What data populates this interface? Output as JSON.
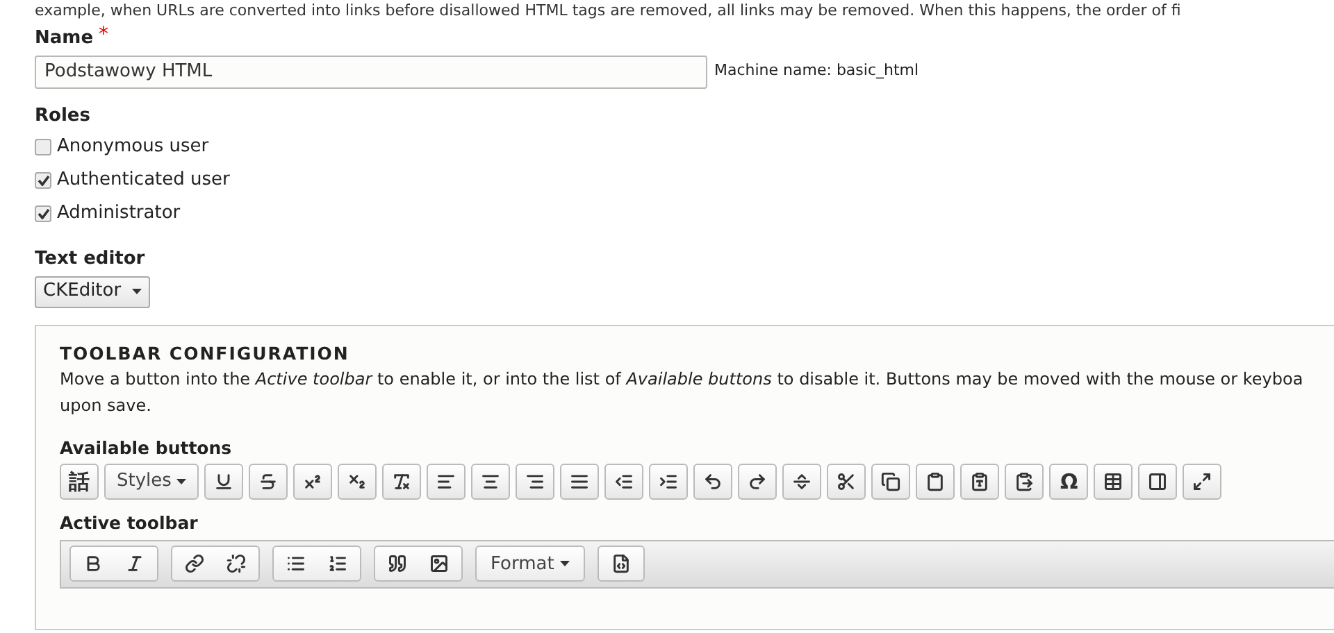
{
  "intro_text": "example, when URLs are converted into links before disallowed HTML tags are removed, all links may be removed. When this happens, the order of fi",
  "name_field": {
    "label": "Name",
    "required_mark": "*",
    "value": "Podstawowy HTML",
    "machine_name": "Machine name: basic_html"
  },
  "roles": {
    "label": "Roles",
    "items": [
      {
        "label": "Anonymous user",
        "checked": false
      },
      {
        "label": "Authenticated user",
        "checked": true
      },
      {
        "label": "Administrator",
        "checked": true
      }
    ]
  },
  "text_editor": {
    "label": "Text editor",
    "value": "CKEditor"
  },
  "toolbar_configuration": {
    "title": "TOOLBAR CONFIGURATION",
    "description": [
      "Move a button into the *Active toolbar* to enable it, or into the list of *Available buttons* to disable it. Buttons may be moved with the mouse or keyboa",
      "upon save."
    ],
    "available_label": "Available buttons",
    "available_buttons": [
      {
        "kind": "text",
        "label": "話"
      },
      {
        "kind": "dropdown",
        "label": "Styles"
      },
      {
        "kind": "icon"
      },
      {
        "kind": "icon"
      },
      {
        "kind": "icon"
      },
      {
        "kind": "icon"
      },
      {
        "kind": "icon"
      },
      {
        "kind": "icon"
      },
      {
        "kind": "icon"
      },
      {
        "kind": "icon"
      },
      {
        "kind": "icon"
      },
      {
        "kind": "icon"
      },
      {
        "kind": "icon"
      },
      {
        "kind": "icon"
      },
      {
        "kind": "icon"
      },
      {
        "kind": "icon"
      },
      {
        "kind": "icon"
      },
      {
        "kind": "icon"
      },
      {
        "kind": "icon"
      },
      {
        "kind": "icon"
      },
      {
        "kind": "icon"
      },
      {
        "kind": "text",
        "label": "Ω"
      },
      {
        "kind": "icon"
      },
      {
        "kind": "icon"
      },
      {
        "kind": "icon"
      }
    ],
    "active_label": "Active toolbar",
    "active_groups": [
      {
        "buttons": [
          {
            "kind": "icon"
          },
          {
            "kind": "icon"
          }
        ]
      },
      {
        "buttons": [
          {
            "kind": "icon"
          },
          {
            "kind": "icon"
          }
        ]
      },
      {
        "buttons": [
          {
            "kind": "icon"
          },
          {
            "kind": "icon"
          }
        ]
      },
      {
        "buttons": [
          {
            "kind": "icon"
          },
          {
            "kind": "icon"
          }
        ]
      },
      {
        "buttons": [
          {
            "kind": "dropdown",
            "label": "Format"
          }
        ]
      },
      {
        "buttons": [
          {
            "kind": "icon"
          }
        ]
      }
    ]
  }
}
